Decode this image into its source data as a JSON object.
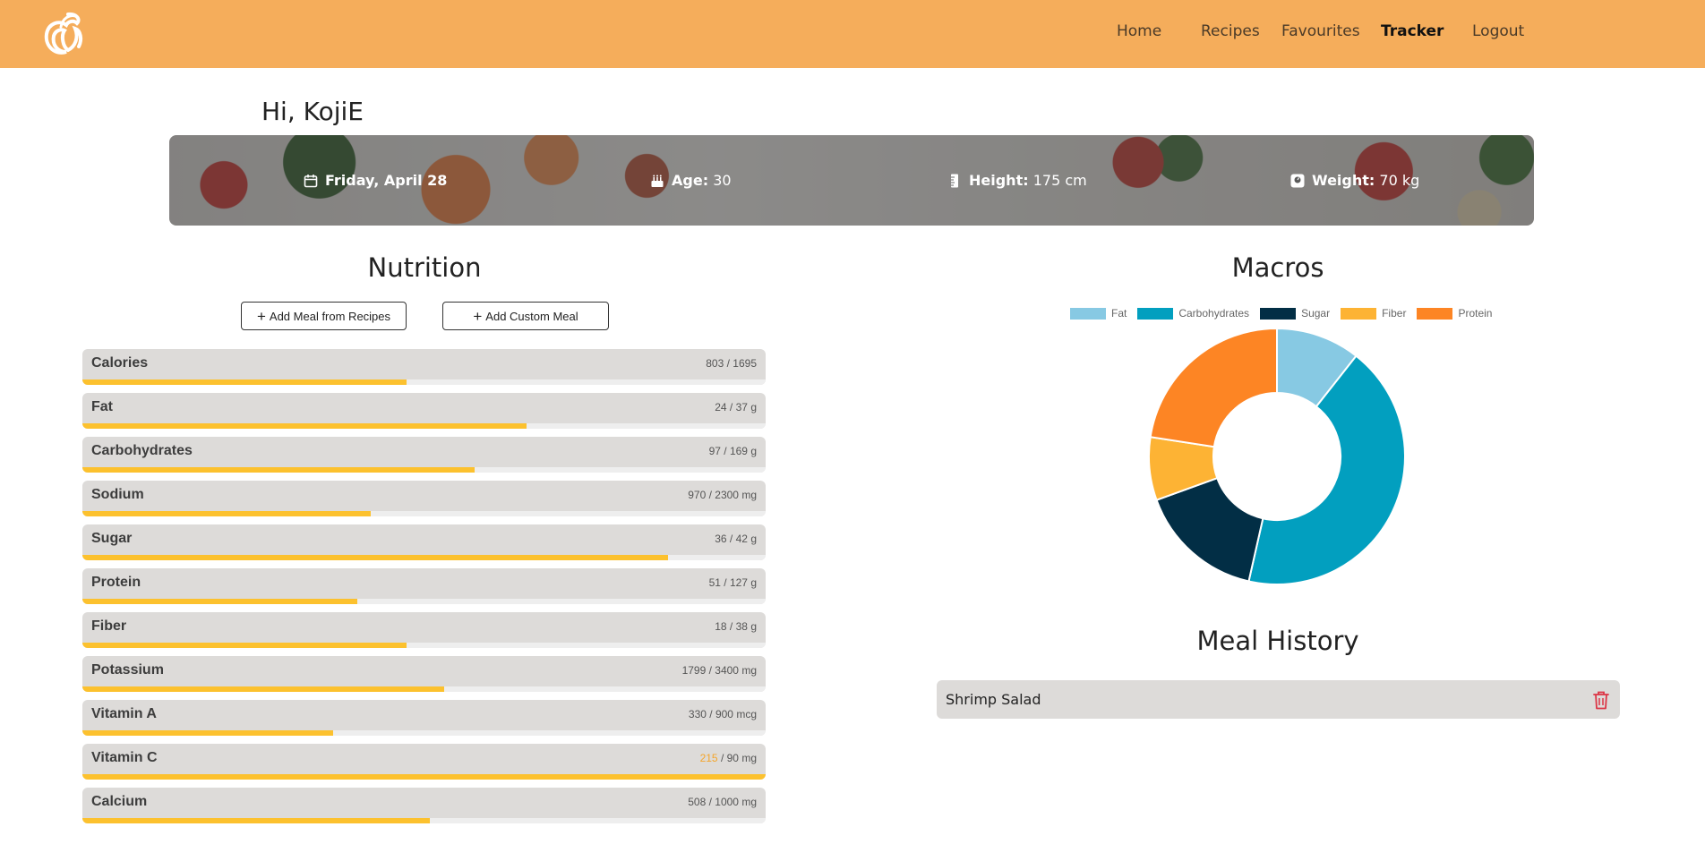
{
  "nav": {
    "items": [
      {
        "label": "Home",
        "active": false
      },
      {
        "label": "Recipes",
        "active": false
      },
      {
        "label": "Favourites",
        "active": false
      },
      {
        "label": "Tracker",
        "active": true
      },
      {
        "label": "Logout",
        "active": false
      }
    ]
  },
  "greeting": "Hi, KojiE",
  "banner": {
    "date": "Friday, April 28",
    "age_label": "Age:",
    "age_value": "30",
    "height_label": "Height:",
    "height_value": "175 cm",
    "weight_label": "Weight:",
    "weight_value": "70 kg"
  },
  "nutrition": {
    "title": "Nutrition",
    "add_recipe_label": "Add Meal from Recipes",
    "add_custom_label": "Add Custom Meal",
    "rows": [
      {
        "label": "Calories",
        "consumed": "803",
        "goal": "1695",
        "unit": "",
        "progress": 0.474,
        "over": false
      },
      {
        "label": "Fat",
        "consumed": "24",
        "goal": "37",
        "unit": "g",
        "progress": 0.65,
        "over": false
      },
      {
        "label": "Carbohydrates",
        "consumed": "97",
        "goal": "169",
        "unit": "g",
        "progress": 0.574,
        "over": false
      },
      {
        "label": "Sodium",
        "consumed": "970",
        "goal": "2300",
        "unit": "mg",
        "progress": 0.422,
        "over": false
      },
      {
        "label": "Sugar",
        "consumed": "36",
        "goal": "42",
        "unit": "g",
        "progress": 0.857,
        "over": false
      },
      {
        "label": "Protein",
        "consumed": "51",
        "goal": "127",
        "unit": "g",
        "progress": 0.402,
        "over": false
      },
      {
        "label": "Fiber",
        "consumed": "18",
        "goal": "38",
        "unit": "g",
        "progress": 0.474,
        "over": false
      },
      {
        "label": "Potassium",
        "consumed": "1799",
        "goal": "3400",
        "unit": "mg",
        "progress": 0.529,
        "over": false
      },
      {
        "label": "Vitamin A",
        "consumed": "330",
        "goal": "900",
        "unit": "mcg",
        "progress": 0.367,
        "over": false
      },
      {
        "label": "Vitamin C",
        "consumed": "215",
        "goal": "90",
        "unit": "mg",
        "progress": 1.0,
        "over": true
      },
      {
        "label": "Calcium",
        "consumed": "508",
        "goal": "1000",
        "unit": "mg",
        "progress": 0.508,
        "over": false
      }
    ]
  },
  "macros": {
    "title": "Macros",
    "colors": {
      "Fat": "#87c9e3",
      "Carbohydrates": "#029fbf",
      "Sugar": "#022e45",
      "Fiber": "#fdb334",
      "Protein": "#fd8524"
    }
  },
  "chart_data": {
    "type": "pie",
    "categories": [
      "Fat",
      "Carbohydrates",
      "Sugar",
      "Fiber",
      "Protein"
    ],
    "values": [
      24,
      97,
      36,
      18,
      51
    ],
    "legend": "top"
  },
  "meal_history": {
    "title": "Meal History",
    "meals": [
      {
        "name": "Shrimp Salad"
      }
    ]
  },
  "icons": {
    "logo": "chef-logo-icon",
    "date": "calendar-icon",
    "age": "cake-icon",
    "height": "ruler-icon",
    "weight": "scale-icon",
    "add": "plus-icon",
    "delete": "trash-icon"
  }
}
